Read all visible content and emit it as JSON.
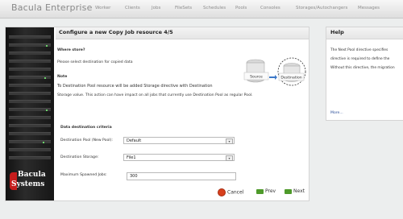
{
  "header": {
    "brand": "Bacula Enterprise",
    "nav": [
      "Worker",
      "Clients",
      "Jobs",
      "FileSets",
      "Schedules",
      "Pools",
      "Consoles",
      "Storages/Autochangers",
      "Messages"
    ]
  },
  "wizard": {
    "title": "Configure a new Copy Job resource 4/5",
    "where_store": "Where store?",
    "instruction": "Please select destination for copied data",
    "note_label": "Note",
    "note_line1": "To Destination Pool resource will be added Storage directive with Destination",
    "note_line2": "Storage value. This action can have impact on all jobs that currently use Destination Pool as regular Pool.",
    "section_title": "Data destination criteria",
    "destination_pool_label": "Destination Pool (New Pool):",
    "destination_pool_value": "Default",
    "destination_storage_label": "Destination Storage:",
    "destination_storage_value": "File1",
    "max_jobs_label": "Maximum Spawned Jobs:",
    "max_jobs_value": "300",
    "diagram": {
      "source_label": "Source",
      "destination_label": "Destination"
    },
    "buttons": {
      "cancel": "Cancel",
      "prev": "Prev",
      "next": "Next"
    },
    "logo_line1": "Bacula",
    "logo_line2": "Systems"
  },
  "help": {
    "title": "Help",
    "line1": "The Next Pool directive specifies",
    "line2": "directive is required to define the",
    "line3": "Without this directive, the migration",
    "more": "More..."
  }
}
